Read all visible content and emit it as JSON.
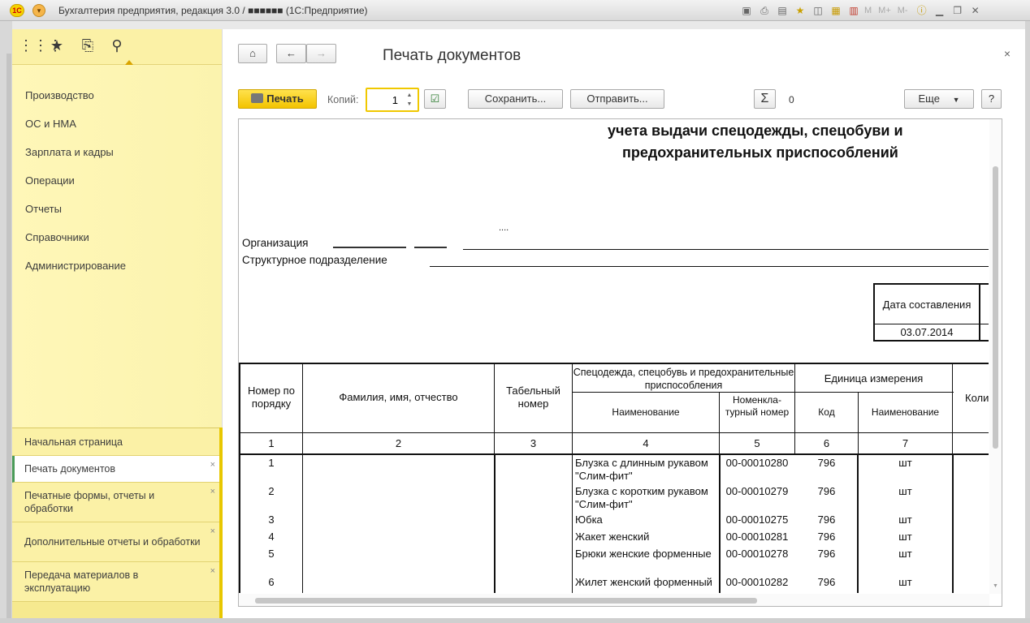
{
  "window": {
    "title": "Бухгалтерия предприятия, редакция 3.0 / ■■■■■■ (1С:Предприятие)",
    "logo_text": "1С",
    "menu_button": "▾",
    "toolbar_text": [
      "M",
      "M+",
      "M-"
    ]
  },
  "sections": [
    "Производство",
    "ОС и НМА",
    "Зарплата и кадры",
    "Операции",
    "Отчеты",
    "Справочники",
    "Администрирование"
  ],
  "open_windows": [
    {
      "label": "Начальная страница",
      "active": false,
      "closable": false
    },
    {
      "label": "Печать документов",
      "active": true,
      "closable": true
    },
    {
      "label": "Печатные формы, отчеты и обработки",
      "active": false,
      "closable": true
    },
    {
      "label": "Дополнительные отчеты и обработки",
      "active": false,
      "closable": true
    },
    {
      "label": "Передача материалов в эксплуатацию",
      "active": false,
      "closable": true
    }
  ],
  "page": {
    "title": "Печать документов",
    "close": "×"
  },
  "toolbar": {
    "print_label": "Печать",
    "copies_label": "Копий:",
    "copies_value": "1",
    "save_label": "Сохранить...",
    "send_label": "Отправить...",
    "sigma_label": "Σ",
    "sigma_value": "0",
    "more_label": "Еще",
    "help_label": "?"
  },
  "document": {
    "title_line1": "учета выдачи спецодежды, спецобуви и",
    "title_line2": "предохранительных приспособлений",
    "org_label": "Организация",
    "org_dots": "....",
    "dept_label": "Структурное подразделение",
    "date_header": "Дата составления",
    "date_value": "03.07.2014",
    "headers": {
      "num": "Номер по порядку",
      "fio": "Фамилия, имя, отчество",
      "tab": "Табельный номер",
      "spec": "Спецодежда, спецобувь и предохранительные приспособления",
      "spec_name": "Наименование",
      "spec_nom": "Номенкла-турный номер",
      "unit": "Единица измерения",
      "unit_code": "Код",
      "unit_name": "Наименование",
      "qty": "Коли"
    },
    "col_numbers": [
      "1",
      "2",
      "3",
      "4",
      "5",
      "6",
      "7"
    ],
    "rows": [
      {
        "n": "1",
        "name": "Блузка с длинным рукавом \"Слим-фит\"",
        "nom": "00-00010280",
        "code": "796",
        "unit": "шт"
      },
      {
        "n": "2",
        "name": "Блузка с коротким рукавом \"Слим-фит\"",
        "nom": "00-00010279",
        "code": "796",
        "unit": "шт"
      },
      {
        "n": "3",
        "name": "Юбка",
        "nom": "00-00010275",
        "code": "796",
        "unit": "шт"
      },
      {
        "n": "4",
        "name": "Жакет женский",
        "nom": "00-00010281",
        "code": "796",
        "unit": "шт"
      },
      {
        "n": "5",
        "name": "Брюки женские форменные",
        "nom": "00-00010278",
        "code": "796",
        "unit": "шт"
      },
      {
        "n": "6",
        "name": "Жилет женский форменный",
        "nom": "00-00010282",
        "code": "796",
        "unit": "шт"
      }
    ]
  }
}
